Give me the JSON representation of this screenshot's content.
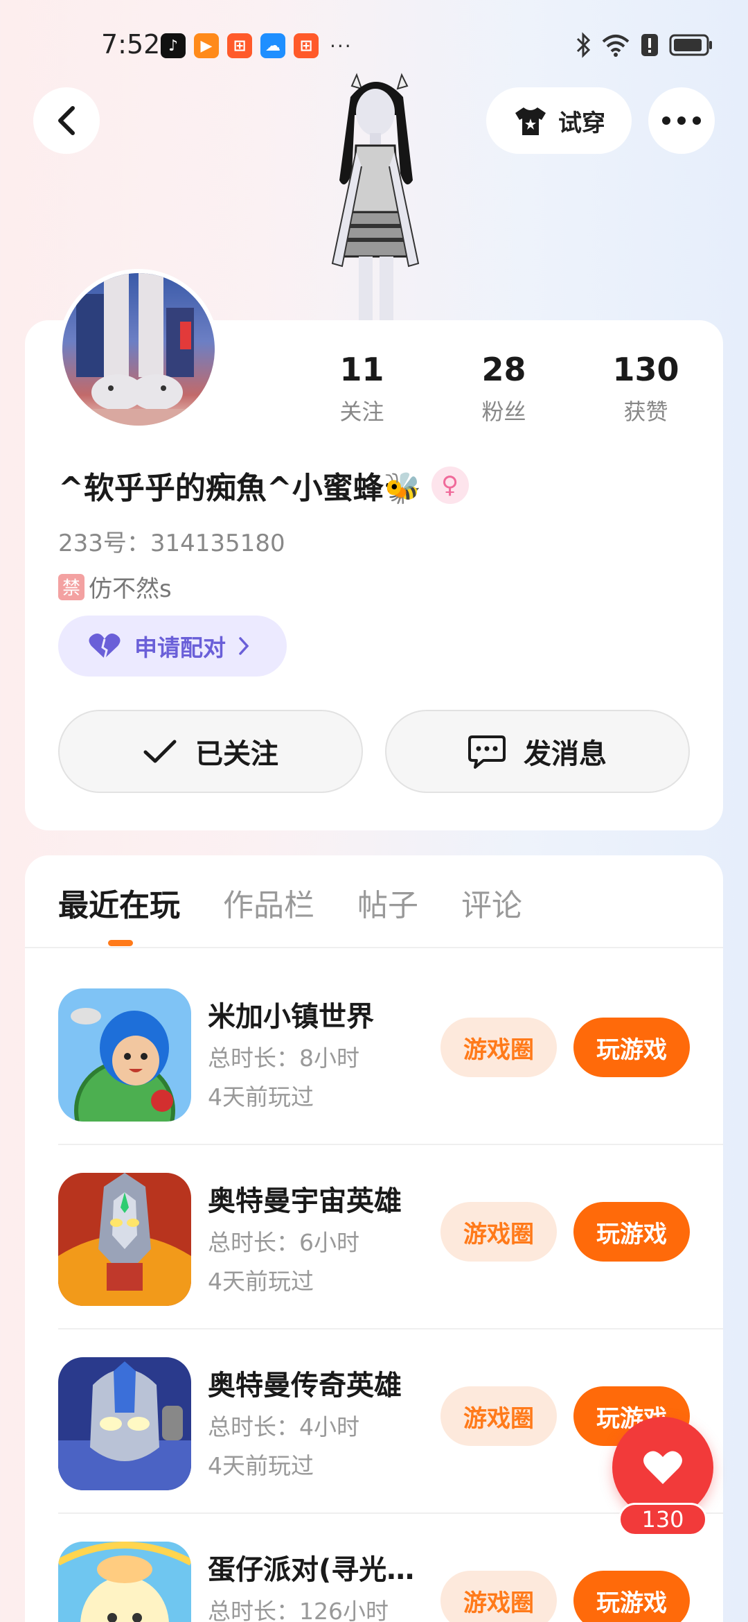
{
  "status_bar": {
    "time": "7:52",
    "more": "···"
  },
  "header": {
    "try_on_label": "试穿"
  },
  "profile": {
    "stats": [
      {
        "value": "11",
        "label": "关注"
      },
      {
        "value": "28",
        "label": "粉丝"
      },
      {
        "value": "130",
        "label": "获赞"
      }
    ],
    "nickname": "^软乎乎的痴魚^小蜜蜂🐝",
    "uid_text": "233号：314135180",
    "tag_chip": "禁",
    "tag_text": "仿不然s",
    "pair_label": "申请配对",
    "follow_label": "已关注",
    "message_label": "发消息"
  },
  "tabs": [
    {
      "label": "最近在玩",
      "active": true
    },
    {
      "label": "作品栏",
      "active": false
    },
    {
      "label": "帖子",
      "active": false
    },
    {
      "label": "评论",
      "active": false
    }
  ],
  "games": [
    {
      "title": "米加小镇世界",
      "duration": "总时长：8小时",
      "last_played": "4天前玩过",
      "circle_label": "游戏圈",
      "play_label": "玩游戏"
    },
    {
      "title": "奥特曼宇宙英雄",
      "duration": "总时长：6小时",
      "last_played": "4天前玩过",
      "circle_label": "游戏圈",
      "play_label": "玩游戏"
    },
    {
      "title": "奥特曼传奇英雄",
      "duration": "总时长：4小时",
      "last_played": "4天前玩过",
      "circle_label": "游戏圈",
      "play_label": "玩游戏"
    },
    {
      "title": "蛋仔派对(寻光…",
      "duration": "总时长：126小时",
      "last_played": "",
      "circle_label": "游戏圈",
      "play_label": "玩游戏"
    }
  ],
  "like": {
    "count": "130"
  },
  "colors": {
    "accent": "#ff6a0a",
    "accent_soft": "#fde9dc",
    "like_red": "#f23a3a",
    "pair_purple": "#6a5fd8"
  }
}
